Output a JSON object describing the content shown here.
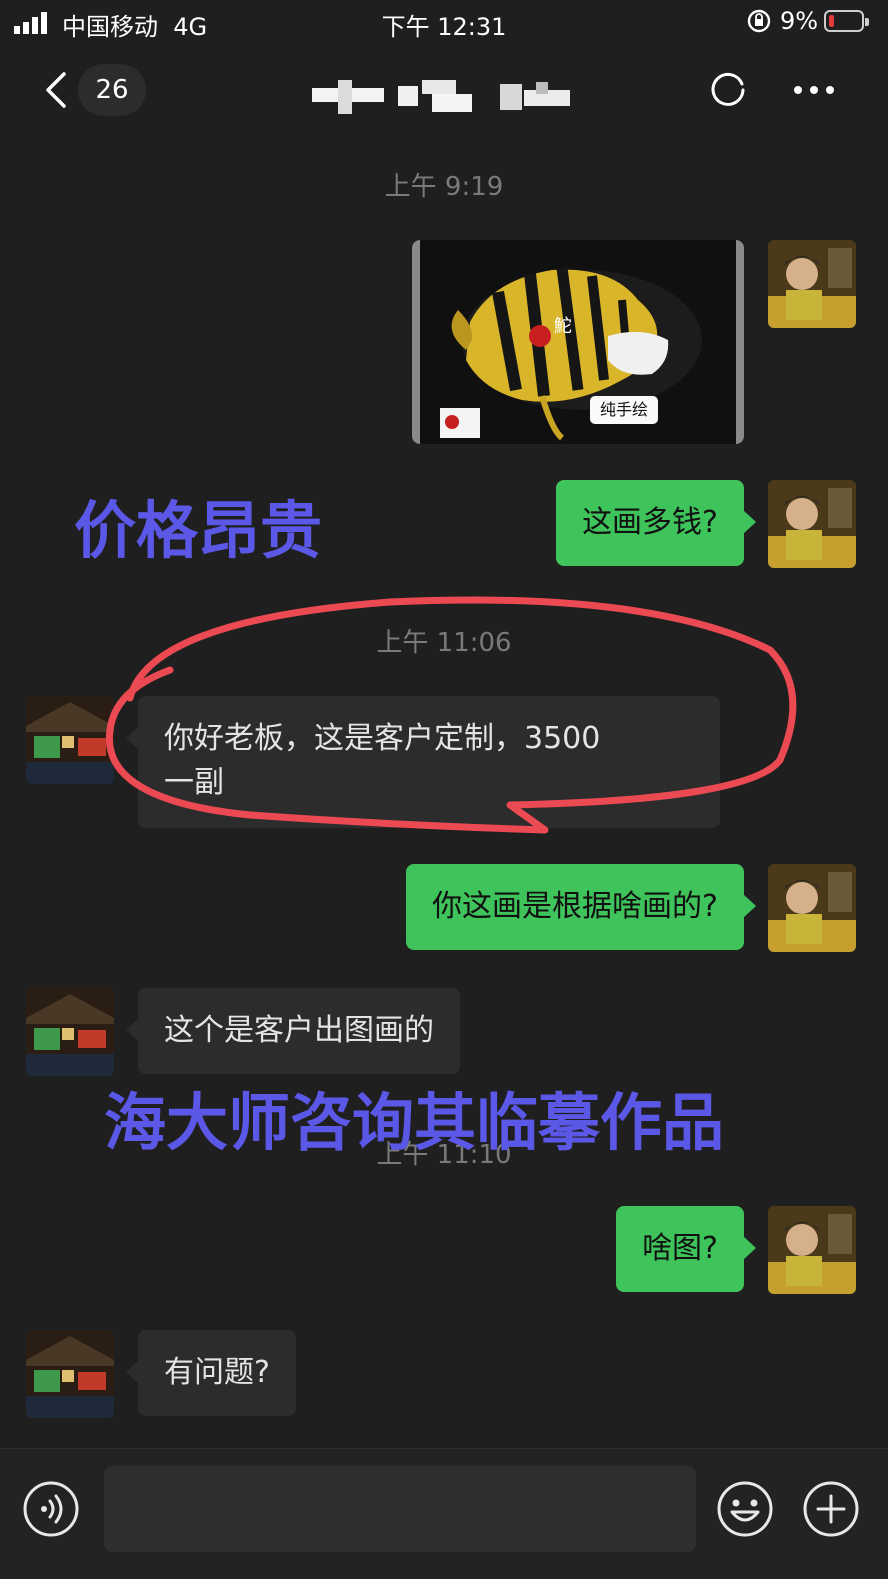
{
  "status_bar": {
    "carrier": "中国移动",
    "network": "4G",
    "time": "下午 12:31",
    "battery": "9%"
  },
  "nav": {
    "unread_count": "26"
  },
  "messages": {
    "ts1": "上午 9:19",
    "image_caption": "纯手绘",
    "msg1": "这画多钱?",
    "ts2": "上午 11:06",
    "msg2_line1": "你好老板，这是客户定制，3500",
    "msg2_line2": "一副",
    "msg3": "你这画是根据啥画的?",
    "msg4": "这个是客户出图画的",
    "ts3": "上午 11:10",
    "msg5": "啥图?",
    "msg6": "有问题?"
  },
  "annotations": {
    "price_note": "价格昂贵",
    "consult_note": "海大师咨询其临摹作品"
  },
  "colors": {
    "sent_bubble": "#3ec45b",
    "recv_bubble": "#2c2c2c",
    "annotation_text": "#5b58e8",
    "circle_mark": "#ec4a52"
  }
}
